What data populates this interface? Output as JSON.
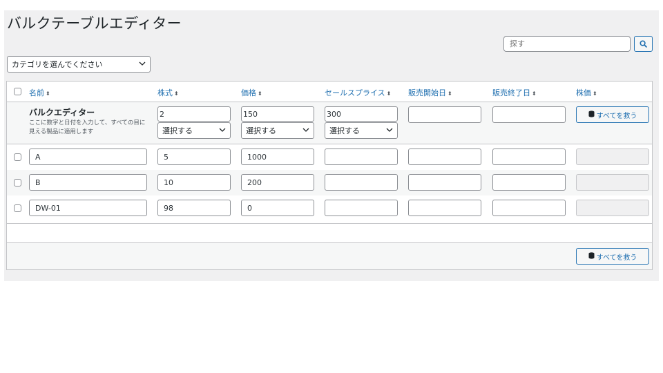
{
  "page": {
    "title": "バルクテーブルエディター"
  },
  "search": {
    "placeholder": "探す",
    "button_icon": "search-icon"
  },
  "category": {
    "selected": "カテゴリを選んでください"
  },
  "table": {
    "headers": {
      "name": "名前",
      "stock": "株式",
      "price": "価格",
      "sale_price": "セールスプライス",
      "sale_start": "販売開始日",
      "sale_end": "販売終了日",
      "stock_price": "株価"
    },
    "bulk_editor": {
      "title": "バルクエディター",
      "description": "ここに数字と日付を入力して、すべての目に見える製品に適用します",
      "stock": "2",
      "price": "150",
      "sale_price": "300",
      "sale_start": "",
      "sale_end": "",
      "select_label": "選択する",
      "save_all_label": "すべてを救う"
    },
    "rows": [
      {
        "name": "A",
        "stock": "5",
        "price": "1000",
        "sale_price": "",
        "sale_start": "",
        "sale_end": "",
        "stock_price": ""
      },
      {
        "name": "B",
        "stock": "10",
        "price": "200",
        "sale_price": "",
        "sale_start": "",
        "sale_end": "",
        "stock_price": ""
      },
      {
        "name": "DW-01",
        "stock": "98",
        "price": "0",
        "sale_price": "",
        "sale_start": "",
        "sale_end": "",
        "stock_price": ""
      }
    ],
    "footer": {
      "save_all_label": "すべてを救う"
    }
  },
  "colors": {
    "accent": "#2271b1",
    "panel_bg": "#f0f0f1",
    "border": "#c3c4c7"
  }
}
